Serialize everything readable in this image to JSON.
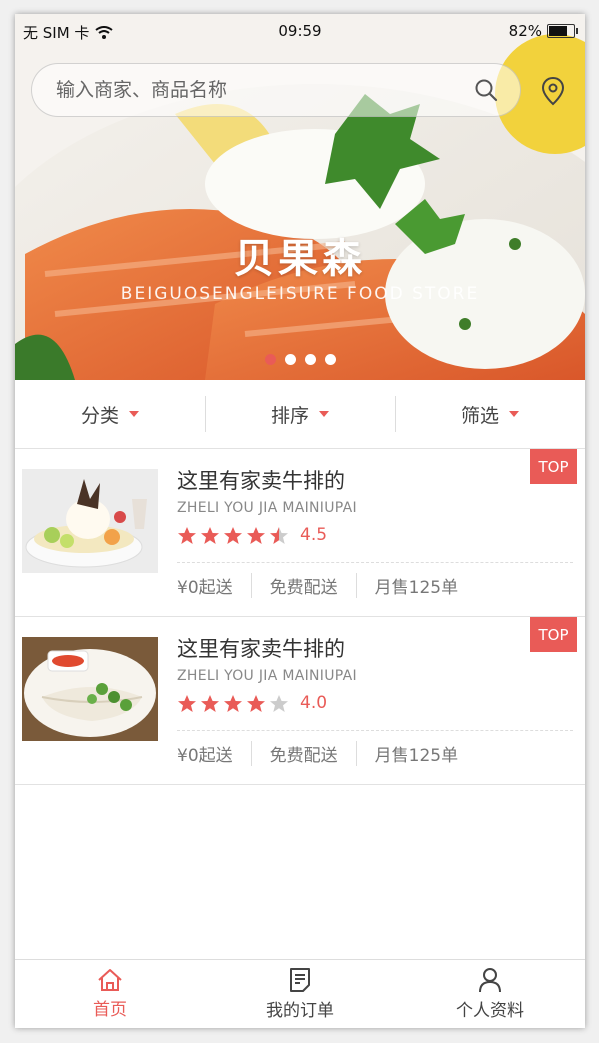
{
  "status": {
    "carrier": "无 SIM 卡",
    "time": "09:59",
    "battery": "82%",
    "battery_level": 0.82
  },
  "search": {
    "placeholder": "输入商家、商品名称"
  },
  "banner": {
    "title": "贝果森",
    "subtitle": "BEIGUOSENGLEISURE   FOOD   STORE",
    "slides": 4,
    "active_slide": 1
  },
  "filters": [
    {
      "label": "分类"
    },
    {
      "label": "排序"
    },
    {
      "label": "筛选"
    }
  ],
  "shops": [
    {
      "name": "这里有家卖牛排的",
      "pinyin": "ZHELI YOU JIA MAINIUPAI",
      "rating": "4.5",
      "stars": 4.5,
      "min_order": "¥0起送",
      "delivery": "免费配送",
      "monthly_sales": "月售125单",
      "badge": "TOP"
    },
    {
      "name": "这里有家卖牛排的",
      "pinyin": "ZHELI YOU JIA MAINIUPAI",
      "rating": "4.0",
      "stars": 4.0,
      "min_order": "¥0起送",
      "delivery": "免费配送",
      "monthly_sales": "月售125单",
      "badge": "TOP"
    }
  ],
  "tabbar": [
    {
      "label": "首页",
      "icon": "home-icon",
      "active": true
    },
    {
      "label": "我的订单",
      "icon": "order-icon",
      "active": false
    },
    {
      "label": "个人资料",
      "icon": "person-icon",
      "active": false
    }
  ],
  "colors": {
    "accent": "#e95b57",
    "star_off": "#cccccc"
  }
}
